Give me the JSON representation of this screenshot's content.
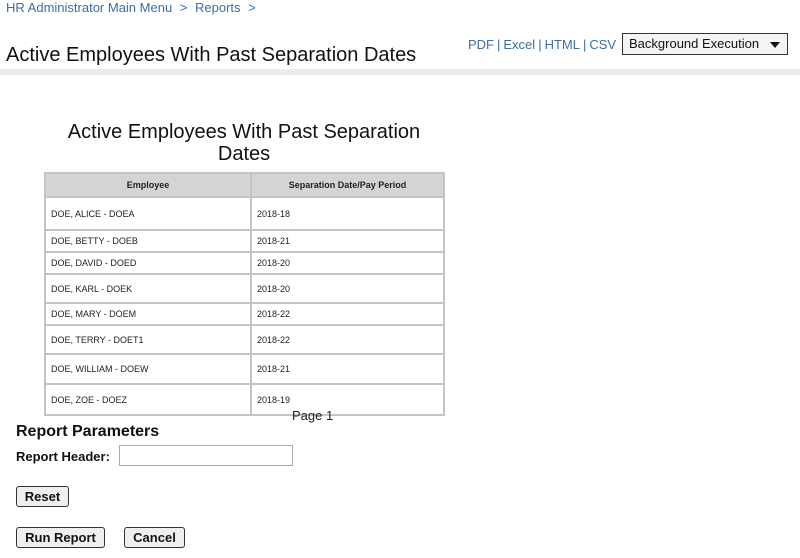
{
  "breadcrumb": {
    "items": [
      "HR Administrator Main Menu",
      "Reports"
    ],
    "separator": ">"
  },
  "header": {
    "title": "Active Employees With Past Separation Dates",
    "export_links": [
      "PDF",
      "Excel",
      "HTML",
      "CSV"
    ],
    "link_separator": "|",
    "execution_select": {
      "selected": "Background Execution"
    }
  },
  "report": {
    "title": "Active Employees With Past Separation Dates",
    "columns": [
      "Employee",
      "Separation Date/Pay Period"
    ],
    "rows": [
      [
        "DOE, ALICE - DOEA",
        "2018-18"
      ],
      [
        "DOE, BETTY - DOEB",
        "2018-21"
      ],
      [
        "DOE, DAVID - DOED",
        "2018-20"
      ],
      [
        "DOE, KARL - DOEK",
        "2018-20"
      ],
      [
        "DOE, MARY - DOEM",
        "2018-22"
      ],
      [
        "DOE, TERRY - DOET1",
        "2018-22"
      ],
      [
        "DOE, WILLIAM - DOEW",
        "2018-21"
      ],
      [
        "DOE, ZOE - DOEZ",
        "2018-19"
      ]
    ],
    "page_label": "Page 1"
  },
  "parameters": {
    "title": "Report Parameters",
    "report_header_label": "Report Header:",
    "report_header_value": "",
    "reset_label": "Reset",
    "run_label": "Run Report",
    "cancel_label": "Cancel"
  },
  "colors": {
    "link": "#3a6ea5",
    "table_header_bg": "#d4d4d4",
    "table_border": "#c4c4c4"
  }
}
